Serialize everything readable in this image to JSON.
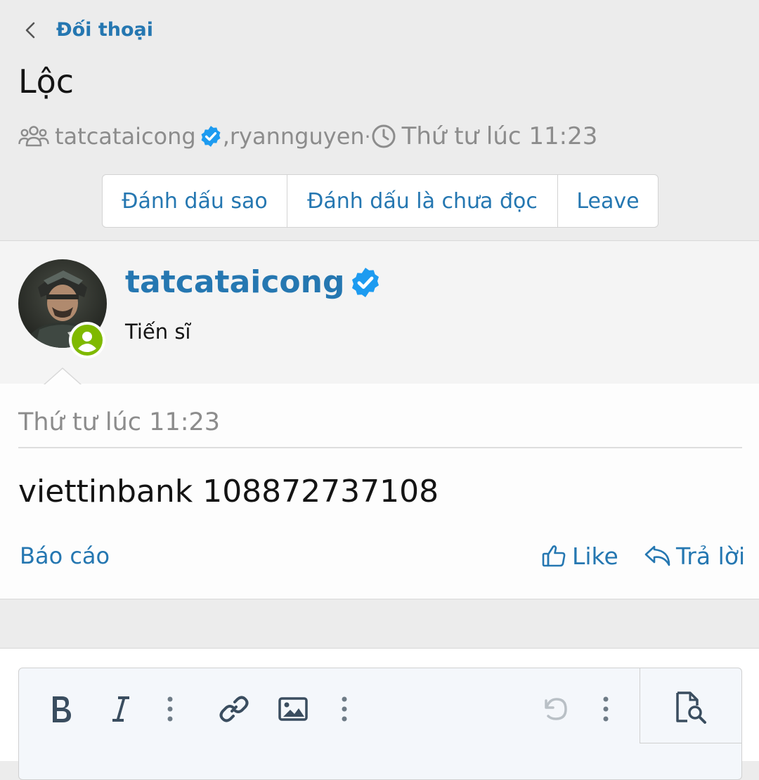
{
  "header": {
    "breadcrumb": "Đối thoại",
    "title": "Lộc",
    "participant_1": "tatcataicong",
    "separator": ", ",
    "participant_2": "ryannguyen",
    "dot": " · ",
    "started": "Thứ tư lúc 11:23"
  },
  "actions": {
    "star": "Đánh dấu sao",
    "mark_unread": "Đánh dấu là chưa đọc",
    "leave": "Leave"
  },
  "message": {
    "username": "tatcataicong",
    "user_title": "Tiến sĩ",
    "date": "Thứ tư lúc 11:23",
    "text": "viettinbank 108872737108",
    "report": "Báo cáo",
    "like": "Like",
    "reply": "Trả lời"
  },
  "colors": {
    "accent": "#2577b1",
    "verified": "#1d9bf0",
    "online": "#7fb900"
  },
  "icons": [
    "back-icon",
    "users-icon",
    "verified-icon",
    "clock-icon",
    "online-icon",
    "like-icon",
    "reply-icon",
    "bold-icon",
    "italic-icon",
    "more-icon",
    "link-icon",
    "image-icon",
    "undo-icon",
    "preview-icon"
  ]
}
